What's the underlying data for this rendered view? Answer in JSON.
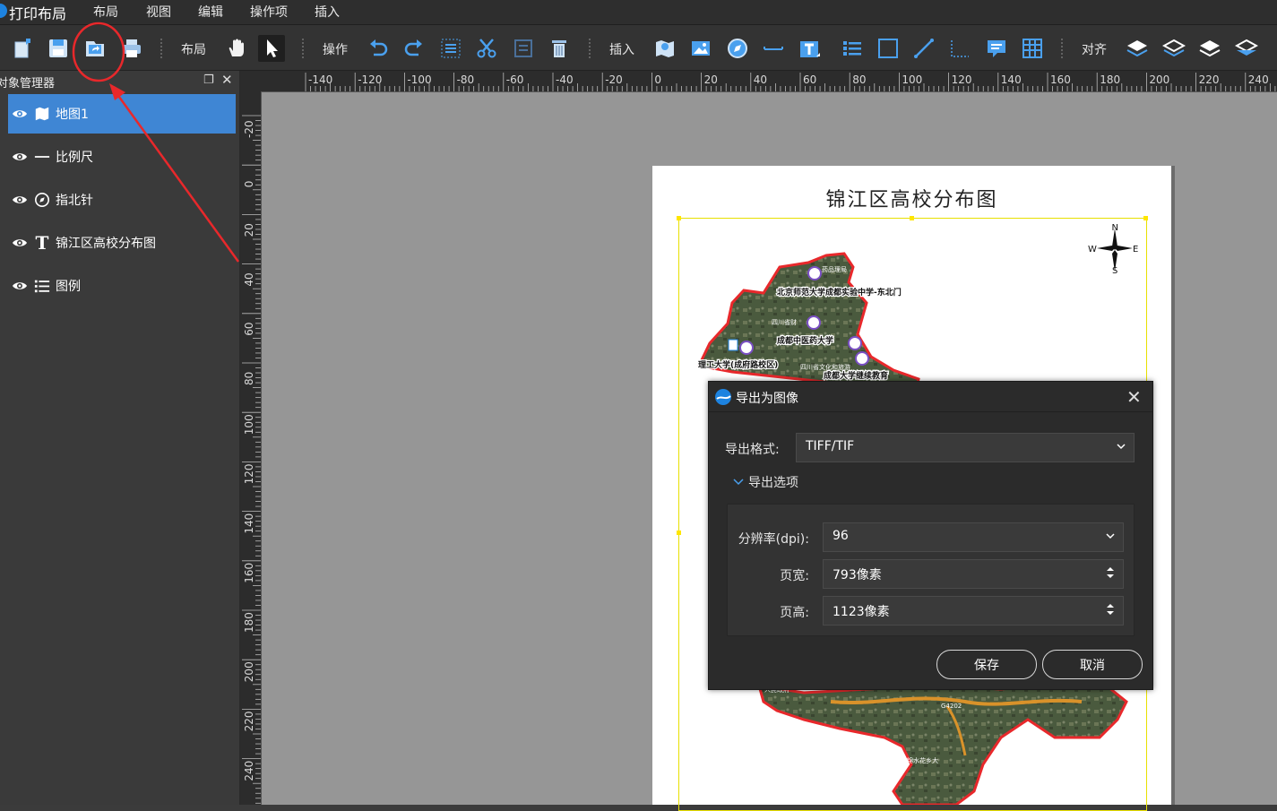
{
  "menubar": {
    "app_title": "打印布局",
    "items": [
      "布局",
      "视图",
      "编辑",
      "操作项",
      "插入"
    ]
  },
  "toolbar": {
    "layout_label": "布局",
    "operate_label": "操作",
    "insert_label": "插入",
    "align_label": "对齐"
  },
  "object_panel": {
    "title": "对象管理器",
    "items": [
      {
        "label": "地图1",
        "icon": "map-icon",
        "selected": true
      },
      {
        "label": "比例尺",
        "icon": "scale-bar-icon",
        "selected": false
      },
      {
        "label": "指北针",
        "icon": "compass-icon",
        "selected": false
      },
      {
        "label": "锦江区高校分布图",
        "icon": "text-icon",
        "selected": false
      },
      {
        "label": "图例",
        "icon": "legend-icon",
        "selected": false
      }
    ]
  },
  "ruler": {
    "h_labels": [
      "-140",
      "-120",
      "-100",
      "-80",
      "-60",
      "-40",
      "-20",
      "0",
      "20",
      "40",
      "60",
      "80",
      "100",
      "120",
      "140",
      "160",
      "180",
      "200",
      "220",
      "240"
    ],
    "v_labels": [
      "-20",
      "0",
      "20",
      "40",
      "60",
      "80",
      "100",
      "120",
      "140",
      "160",
      "180",
      "200",
      "220",
      "240"
    ]
  },
  "page": {
    "title": "锦江区高校分布图",
    "compass": {
      "n": "N",
      "s": "S",
      "w": "W",
      "e": "E"
    },
    "map_labels": [
      "北京师范大学成都实验中学-东北门",
      "成都中医药大学",
      "理工大学(成府路校区)",
      "成都大学继续教育",
      "四川省财",
      "四川省文化和旅游",
      "药品理局",
      "人民政府",
      "G4202",
      "锦水花乡大"
    ]
  },
  "dialog": {
    "title": "导出为图像",
    "format_label": "导出格式:",
    "format_value": "TIFF/TIF",
    "options_label": "导出选项",
    "dpi_label": "分辨率(dpi):",
    "dpi_value": "96",
    "width_label": "页宽:",
    "width_value": "793像素",
    "height_label": "页高:",
    "height_value": "1123像素",
    "save_label": "保存",
    "cancel_label": "取消"
  },
  "colors": {
    "accent": "#3f86d4",
    "annotation_red": "#e8282b",
    "frame_yellow": "#e8e000"
  }
}
